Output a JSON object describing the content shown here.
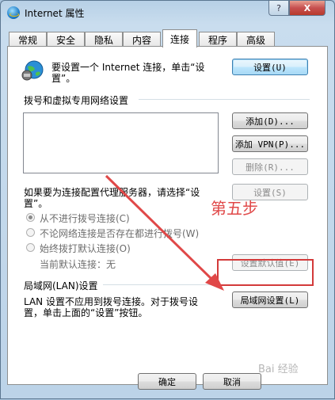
{
  "window": {
    "title": "Internet 属性",
    "help_label": "?",
    "close_label": "X"
  },
  "tabs": [
    {
      "label": "常规"
    },
    {
      "label": "安全"
    },
    {
      "label": "隐私"
    },
    {
      "label": "内容"
    },
    {
      "label": "连接",
      "active": true
    },
    {
      "label": "程序"
    },
    {
      "label": "高级"
    }
  ],
  "connection": {
    "setup_text_line1": "要设置一个 Internet 连接，单击“设",
    "setup_text_line2": "置”。",
    "setup_button": "设置(U)",
    "dialup_section_title": "拨号和虚拟专用网络设置",
    "add_button": "添加(D)...",
    "add_vpn_button": "添加 VPN(P)...",
    "remove_button": "删除(R)...",
    "proxy_text_line1": "如果要为连接配置代理服务器，请选择“设",
    "proxy_text_line2": "置”。",
    "settings_button": "设置(S)",
    "radio_never": "从不进行拨号连接(C)",
    "radio_when_no_network": "不论网络连接是否存在都进行拨号(W)",
    "radio_always": "始终拨打默认连接(O)",
    "current_default_label": "当前默认连接：无",
    "set_default_button": "设置默认值(E)",
    "lan_section_title": "局域网(LAN)设置",
    "lan_text_line1": "LAN 设置不应用到拨号连接。对于拨号设",
    "lan_text_line2": "置，单击上面的“设置”按钮。",
    "lan_settings_button": "局域网设置(L)"
  },
  "annotation": {
    "text": "第五步",
    "color": "#e04848"
  },
  "footer": {
    "ok_button": "确定",
    "cancel_button": "取消"
  },
  "watermark": "Bai 经验"
}
